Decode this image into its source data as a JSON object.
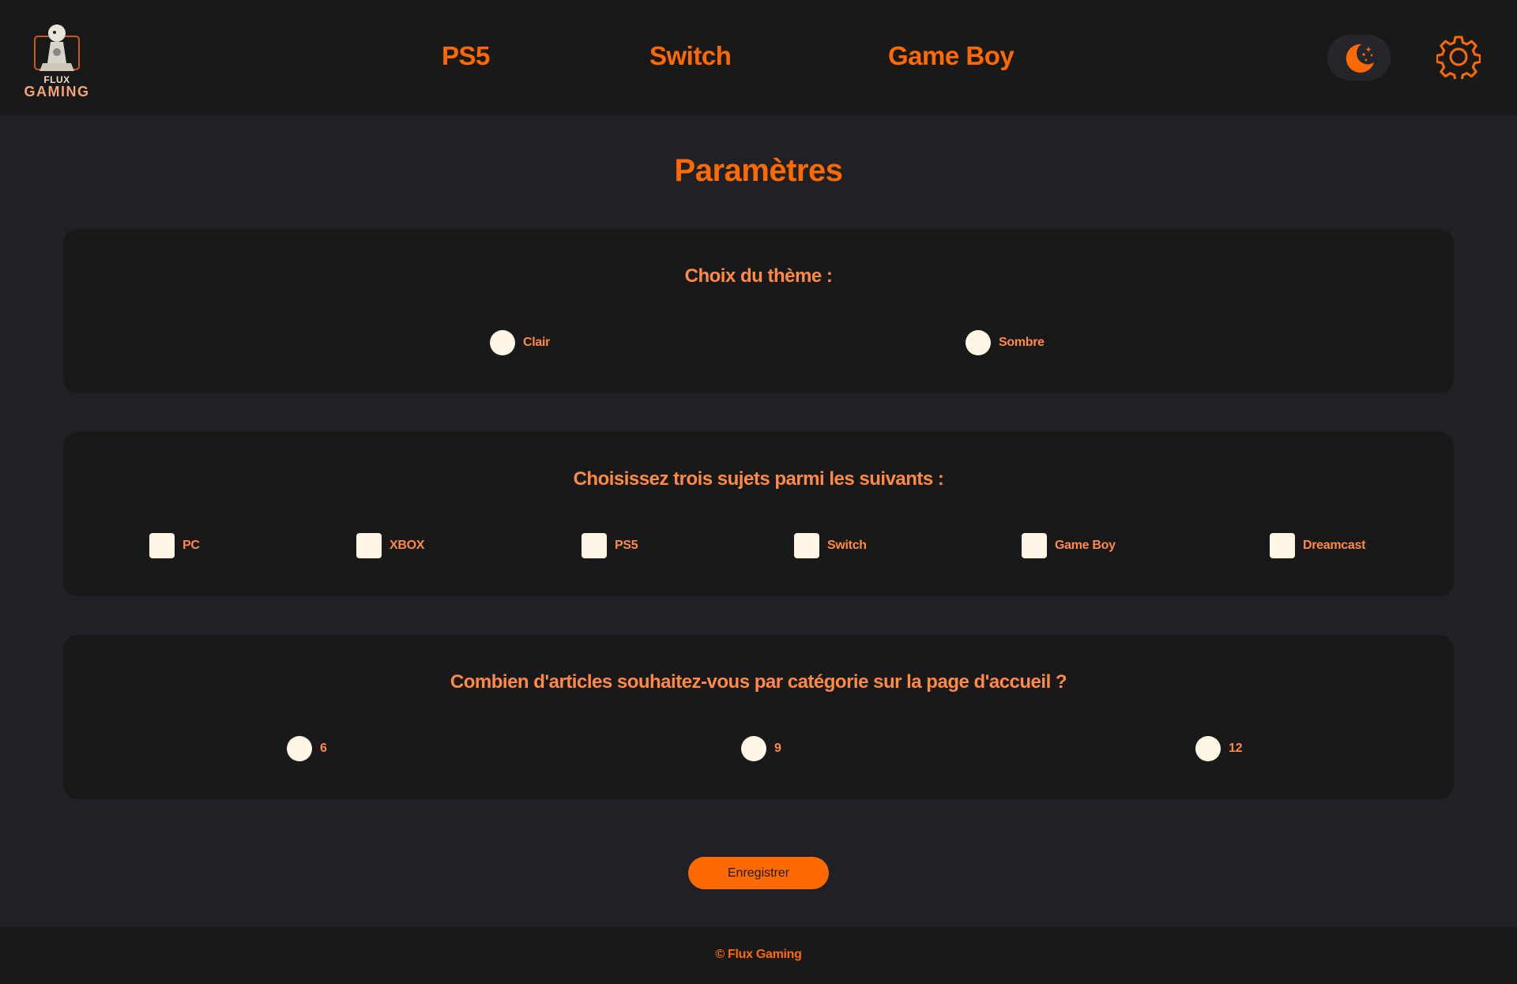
{
  "header": {
    "logo": {
      "line1": "FLUX",
      "line2": "GAMING"
    },
    "nav": [
      {
        "label": "PS5"
      },
      {
        "label": "Switch"
      },
      {
        "label": "Game Boy"
      }
    ]
  },
  "page": {
    "title": "Paramètres"
  },
  "theme": {
    "title": "Choix du thème :",
    "options": [
      {
        "label": "Clair"
      },
      {
        "label": "Sombre"
      }
    ]
  },
  "topics": {
    "title": "Choisissez trois sujets parmi les suivants :",
    "options": [
      {
        "label": "PC"
      },
      {
        "label": "XBOX"
      },
      {
        "label": "PS5"
      },
      {
        "label": "Switch"
      },
      {
        "label": "Game Boy"
      },
      {
        "label": "Dreamcast"
      }
    ]
  },
  "articles": {
    "title": "Combien d'articles souhaitez-vous par catégorie sur la page d'accueil ?",
    "options": [
      {
        "label": "6"
      },
      {
        "label": "9"
      },
      {
        "label": "12"
      }
    ]
  },
  "actions": {
    "save_label": "Enregistrer"
  },
  "footer": {
    "text": "© Flux Gaming"
  },
  "colors": {
    "accent": "#ff6a00",
    "accent_light": "#ff8a45",
    "background": "#202126",
    "panel": "#191919",
    "control_fill": "#fef5e4"
  },
  "icons": {
    "theme_toggle": "moon-stars-icon",
    "settings": "gear-icon"
  }
}
